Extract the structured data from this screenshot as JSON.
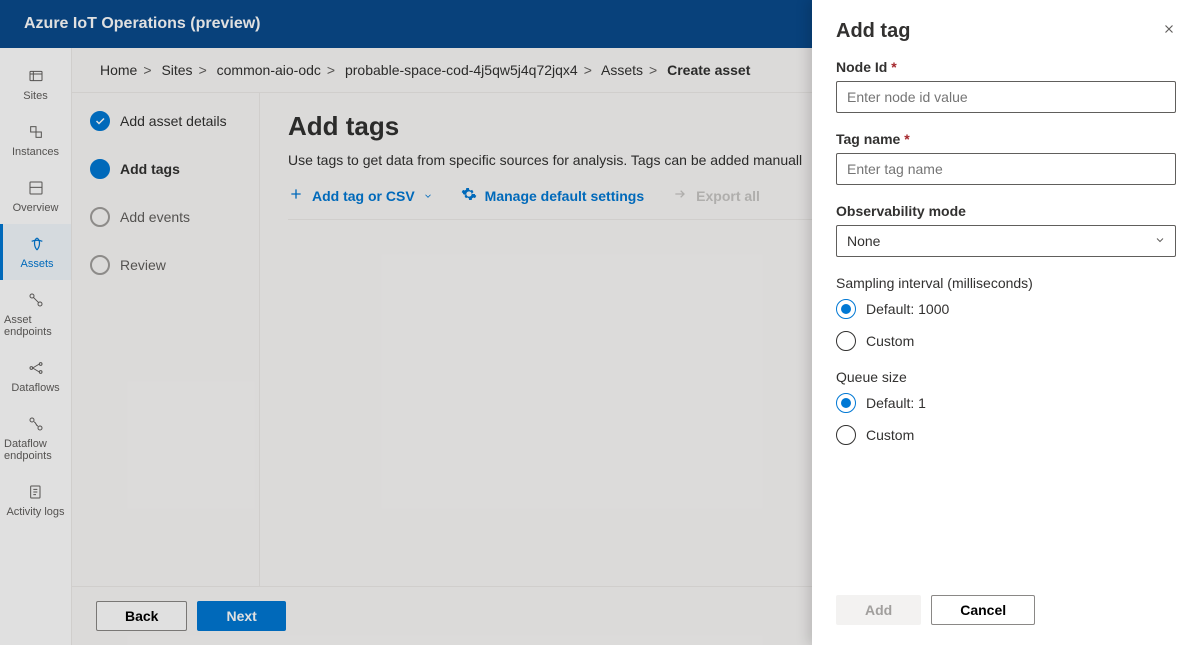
{
  "header": {
    "title": "Azure IoT Operations (preview)"
  },
  "sidebar": {
    "items": [
      {
        "label": "Sites"
      },
      {
        "label": "Instances"
      },
      {
        "label": "Overview"
      },
      {
        "label": "Assets"
      },
      {
        "label": "Asset endpoints"
      },
      {
        "label": "Dataflows"
      },
      {
        "label": "Dataflow endpoints"
      },
      {
        "label": "Activity logs"
      }
    ]
  },
  "breadcrumb": {
    "parts": [
      "Home",
      "Sites",
      "common-aio-odc",
      "probable-space-cod-4j5qw5j4q72jqx4",
      "Assets"
    ],
    "current": "Create asset"
  },
  "steps": [
    {
      "label": "Add asset details"
    },
    {
      "label": "Add tags"
    },
    {
      "label": "Add events"
    },
    {
      "label": "Review"
    }
  ],
  "content": {
    "title": "Add tags",
    "description": "Use tags to get data from specific sources for analysis. Tags can be added manuall",
    "actions": {
      "add": "Add tag or CSV",
      "manage": "Manage default settings",
      "export": "Export all"
    }
  },
  "footer": {
    "back": "Back",
    "next": "Next"
  },
  "panel": {
    "title": "Add tag",
    "nodeId": {
      "label": "Node Id",
      "placeholder": "Enter node id value"
    },
    "tagName": {
      "label": "Tag name",
      "placeholder": "Enter tag name"
    },
    "observability": {
      "label": "Observability mode",
      "value": "None"
    },
    "sampling": {
      "label": "Sampling interval (milliseconds)",
      "default": "Default: 1000",
      "custom": "Custom"
    },
    "queue": {
      "label": "Queue size",
      "default": "Default: 1",
      "custom": "Custom"
    },
    "buttons": {
      "add": "Add",
      "cancel": "Cancel"
    }
  }
}
